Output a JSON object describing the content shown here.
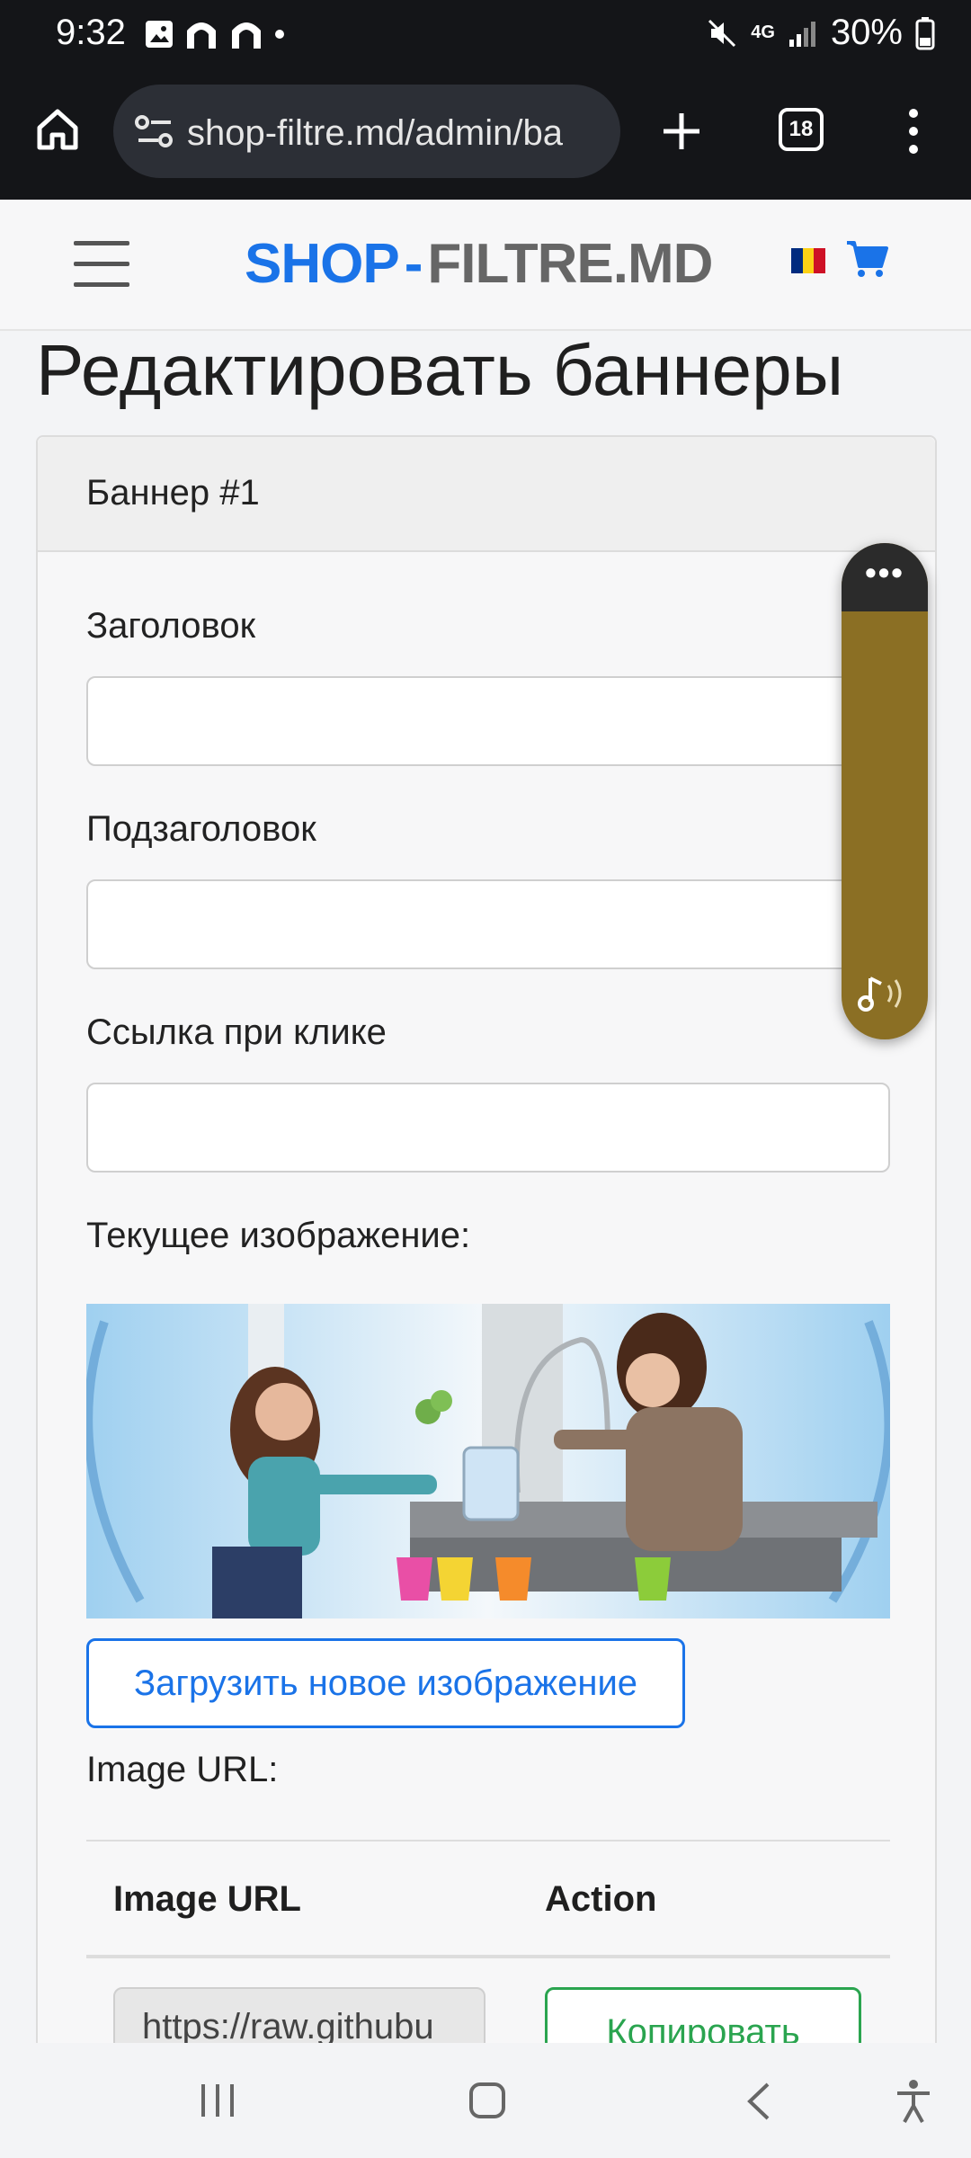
{
  "status_bar": {
    "time": "9:32",
    "network": "4G",
    "battery": "30%"
  },
  "browser": {
    "url": "shop-filtre.md/admin/ba",
    "tab_count": "18"
  },
  "site": {
    "logo_left": "SHOP",
    "logo_dash": "-",
    "logo_right": "FILTRE.MD"
  },
  "page": {
    "title": "Редактировать баннеры"
  },
  "card": {
    "header": "Баннер #1",
    "title_label": "Заголовок",
    "title_value": "",
    "subtitle_label": "Подзаголовок",
    "subtitle_value": "",
    "link_label": "Ссылка при клике",
    "link_value": "",
    "current_image_label": "Текущее изображение:",
    "upload_button": "Загрузить новое изображение",
    "image_url_label": "Image URL:",
    "table": {
      "col_url": "Image URL",
      "col_action": "Action",
      "url_value": "https://raw.githubu",
      "copy_button": "Копировать"
    }
  },
  "colors": {
    "accent_blue": "#1a73e8",
    "success_green": "#2aa44f",
    "widget_gold": "#8b6f24"
  }
}
